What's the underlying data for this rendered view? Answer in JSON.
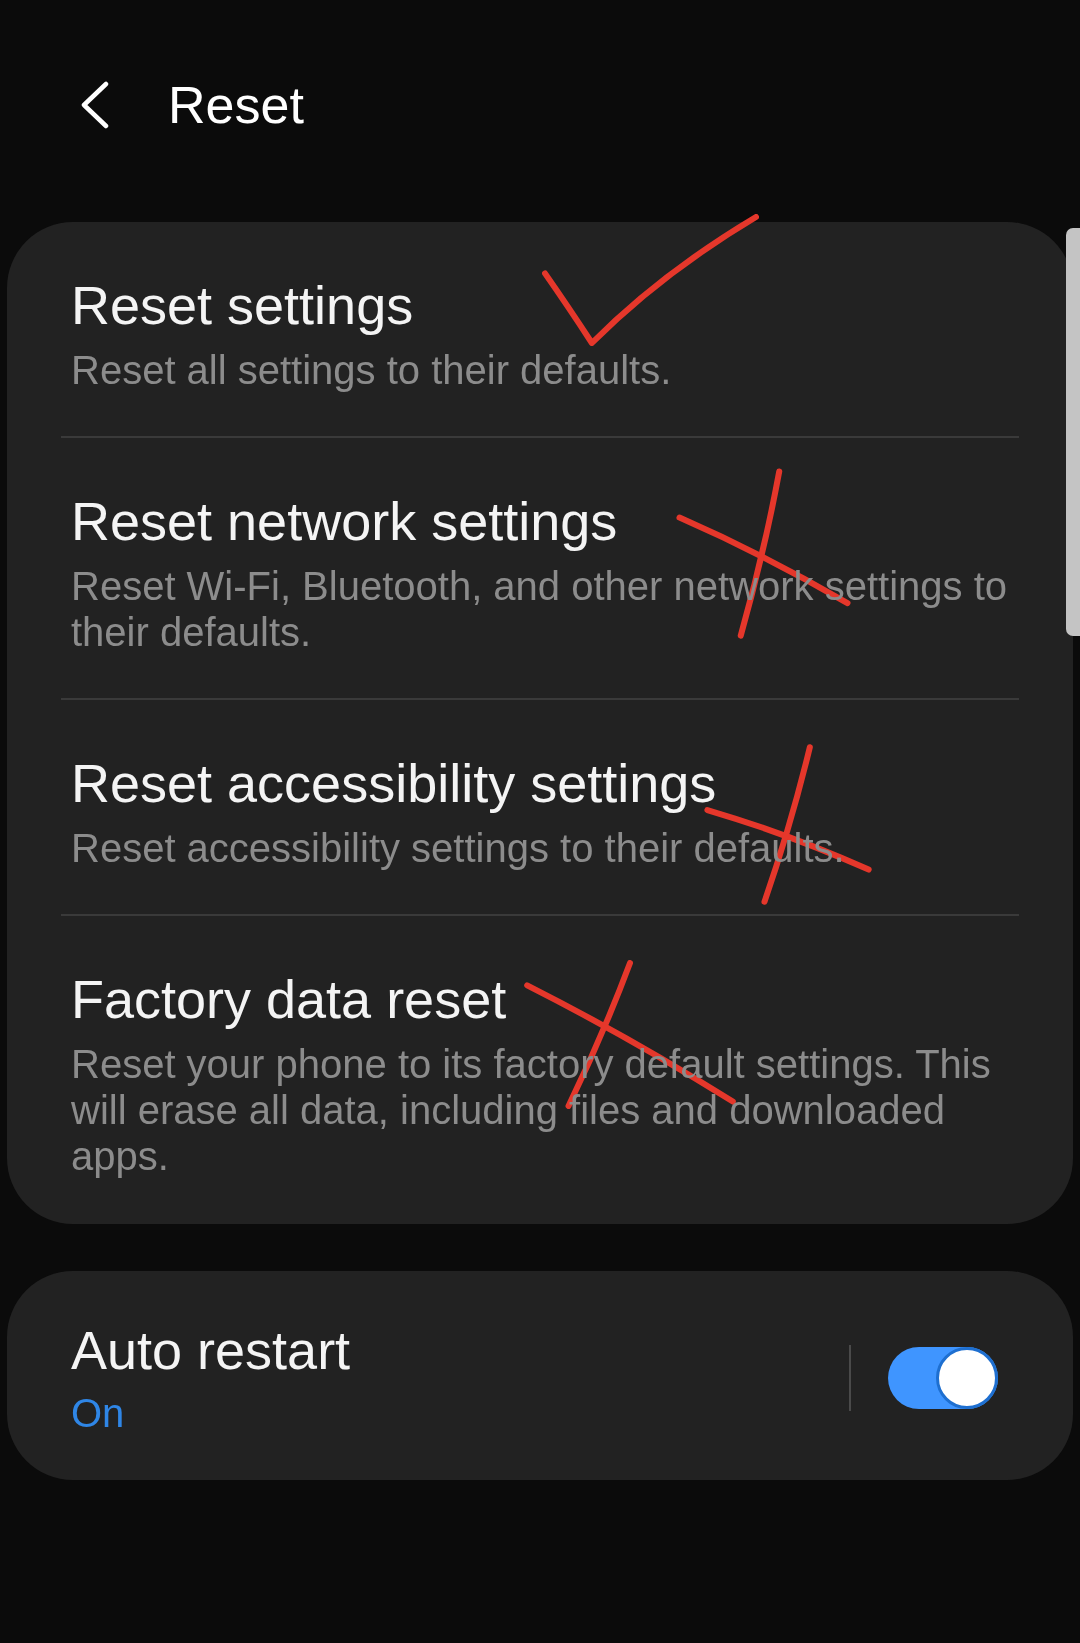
{
  "header": {
    "title": "Reset"
  },
  "reset_options": [
    {
      "title": "Reset settings",
      "description": "Reset all settings to their defaults.",
      "kind": "check"
    },
    {
      "title": "Reset network settings",
      "description": "Reset Wi-Fi, Bluetooth, and other network settings to their defaults.",
      "kind": "cross"
    },
    {
      "title": "Reset accessibility settings",
      "description": "Reset accessibility settings to their defaults.",
      "kind": "cross"
    },
    {
      "title": "Factory data reset",
      "description": "Reset your phone to its factory default settings. This will erase all data, including files and downloaded apps.",
      "kind": "cross"
    }
  ],
  "auto_restart": {
    "title": "Auto restart",
    "status": "On",
    "on": true
  }
}
